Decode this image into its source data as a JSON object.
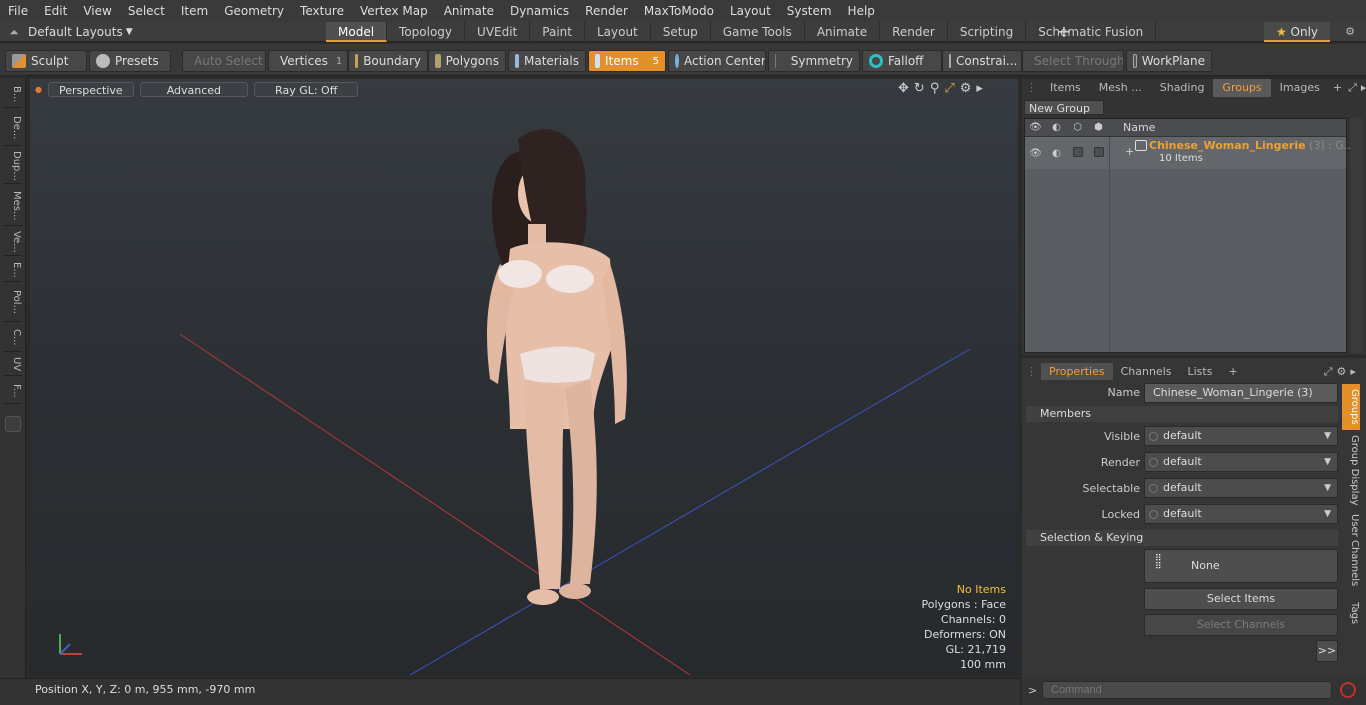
{
  "menu": [
    "File",
    "Edit",
    "View",
    "Select",
    "Item",
    "Geometry",
    "Texture",
    "Vertex Map",
    "Animate",
    "Dynamics",
    "Render",
    "MaxToModo",
    "Layout",
    "System",
    "Help"
  ],
  "layout_label": "Default Layouts",
  "tabs": [
    "Model",
    "Topology",
    "UVEdit",
    "Paint",
    "Layout",
    "Setup",
    "Game Tools",
    "Animate",
    "Render",
    "Scripting",
    "Schematic Fusion"
  ],
  "only_label": "Only",
  "toolbar": {
    "sculpt": "Sculpt",
    "presets": "Presets",
    "auto_select": "Auto Select",
    "vertices": "Vertices",
    "vertices_count": "1",
    "boundary": "Boundary",
    "polygons": "Polygons",
    "materials": "Materials",
    "items": "Items",
    "items_count": "5",
    "action_center": "Action Center",
    "symmetry": "Symmetry",
    "falloff": "Falloff",
    "constraints": "Constrai...",
    "select_through": "Select Through",
    "workplane": "WorkPlane"
  },
  "left_tabs": [
    "B...",
    "De...",
    "Dup...",
    "Mes...",
    "Ve...",
    "E...",
    "Pol...",
    "C...",
    "UV",
    "F..."
  ],
  "viewport": {
    "perspective": "Perspective",
    "advanced": "Advanced",
    "raygl": "Ray GL: Off"
  },
  "stats": {
    "no_items": "No Items",
    "polygons": "Polygons : Face",
    "channels": "Channels: 0",
    "deformers": "Deformers: ON",
    "gl": "GL: 21,719",
    "scale": "100 mm"
  },
  "status": {
    "position": "Position X, Y, Z:   0 m, 955 mm, -970 mm"
  },
  "right_tabs": [
    "Items",
    "Mesh ...",
    "Shading",
    "Groups",
    "Images"
  ],
  "new_group": "New Group",
  "group_header": "Name",
  "group": {
    "name": "Chinese_Woman_Lingerie",
    "suffix": " (3) : G...",
    "items": "10 Items"
  },
  "props_tabs": [
    "Properties",
    "Channels",
    "Lists"
  ],
  "props": {
    "name_label": "Name",
    "name_value": "Chinese_Woman_Lingerie (3)",
    "members": "Members",
    "visible_label": "Visible",
    "render_label": "Render",
    "selectable_label": "Selectable",
    "locked_label": "Locked",
    "default_value": "default",
    "sel_keying": "Selection & Keying",
    "none": "None",
    "select_items": "Select Items",
    "select_channels": "Select Channels",
    "more": ">>"
  },
  "side_tabs": [
    "Groups",
    "Group Display",
    "User Channels",
    "Tags"
  ],
  "command_placeholder": "Command",
  "colors": {
    "accent": "#e3902a",
    "group_name": "#f0a030"
  }
}
